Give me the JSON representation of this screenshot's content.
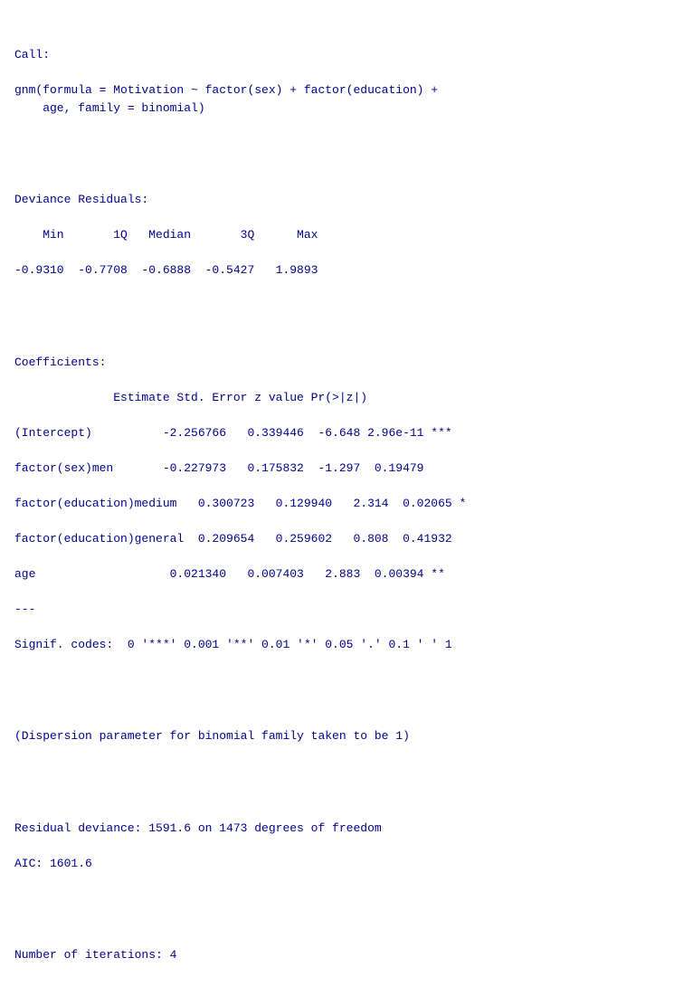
{
  "output": {
    "call_label": "Call:",
    "call_code": "gnm(formula = Motivation ~ factor(sex) + factor(education) +\n    age, family = binomial)",
    "deviance_residuals_label": "Deviance Residuals:",
    "deviance_residuals_headers": "    Min       1Q   Median       3Q      Max",
    "deviance_residuals_values": "-0.9310  -0.7708  -0.6888  -0.5427   1.9893",
    "coefficients_label": "Coefficients:",
    "coefficients_header": "              Estimate Std. Error z value Pr(>|z|)    ",
    "coeff_intercept": "(Intercept)          -2.256766   0.339446  -6.648 2.96e-11 ***",
    "coeff_sex_men": "factor(sex)men       -0.227973   0.175832  -1.297  0.19479    ",
    "coeff_edu_medium": "factor(education)medium   0.300723   0.129940   2.314  0.02065 * ",
    "coeff_edu_general": "factor(education)general  0.209654   0.259602   0.808  0.41932    ",
    "coeff_age": "age                   0.021340   0.007403   2.883  0.00394 **",
    "signif_sep": "---",
    "signif_codes": "Signif. codes:  0 '***' 0.001 '**' 0.01 '*' 0.05 '.' 0.1 ' ' 1",
    "dispersion": "(Dispersion parameter for binomial family taken to be 1)",
    "residual_deviance": "Residual deviance: 1591.6 on 1473 degrees of freedom",
    "aic": "AIC: 1601.6",
    "iterations": "Number of iterations: 4"
  }
}
